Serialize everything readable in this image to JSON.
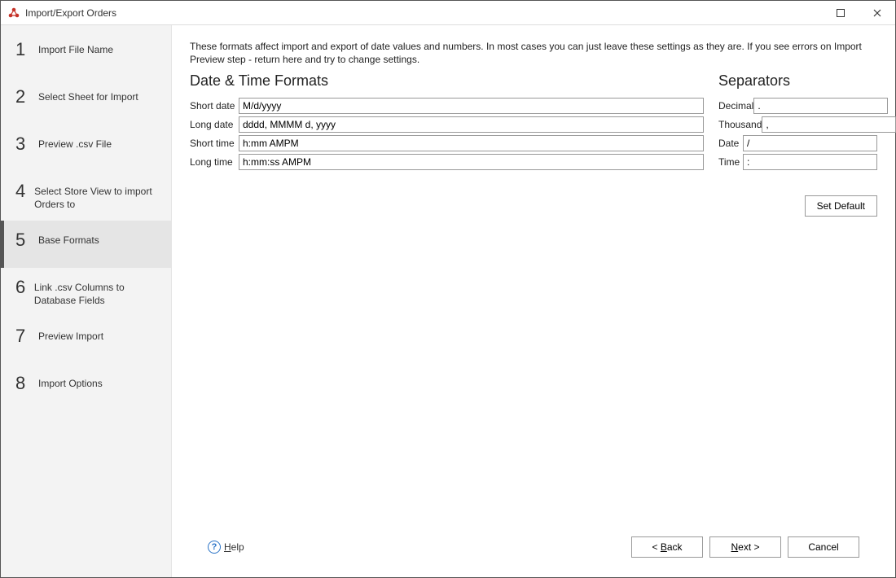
{
  "titlebar": {
    "title": "Import/Export Orders"
  },
  "sidebar": {
    "steps": [
      {
        "num": "1",
        "label": "Import File Name"
      },
      {
        "num": "2",
        "label": "Select Sheet for Import"
      },
      {
        "num": "3",
        "label": "Preview .csv File"
      },
      {
        "num": "4",
        "label": "Select Store View to import Orders to"
      },
      {
        "num": "5",
        "label": "Base Formats"
      },
      {
        "num": "6",
        "label": "Link .csv Columns to Database Fields"
      },
      {
        "num": "7",
        "label": "Preview Import"
      },
      {
        "num": "8",
        "label": "Import Options"
      }
    ],
    "active_index": 4
  },
  "content": {
    "description": "These formats affect import and export of date values and numbers. In most cases you can just leave these settings as they are. If you see errors on Import Preview step - return here and try to change settings.",
    "datetime_heading": "Date & Time Formats",
    "separators_heading": "Separators",
    "datetime": {
      "short_date": {
        "label": "Short date",
        "value": "M/d/yyyy"
      },
      "long_date": {
        "label": "Long date",
        "value": "dddd, MMMM d, yyyy"
      },
      "short_time": {
        "label": "Short time",
        "value": "h:mm AMPM"
      },
      "long_time": {
        "label": "Long time",
        "value": "h:mm:ss AMPM"
      }
    },
    "separators": {
      "decimal": {
        "label": "Decimal",
        "value": "."
      },
      "thousand": {
        "label": "Thousand",
        "value": ","
      },
      "date": {
        "label": "Date",
        "value": "/"
      },
      "time": {
        "label": "Time",
        "value": ":"
      }
    },
    "set_default_label": "Set Default"
  },
  "footer": {
    "help_label": "Help",
    "back_label": "< Back",
    "next_label": "Next >",
    "cancel_label": "Cancel"
  }
}
